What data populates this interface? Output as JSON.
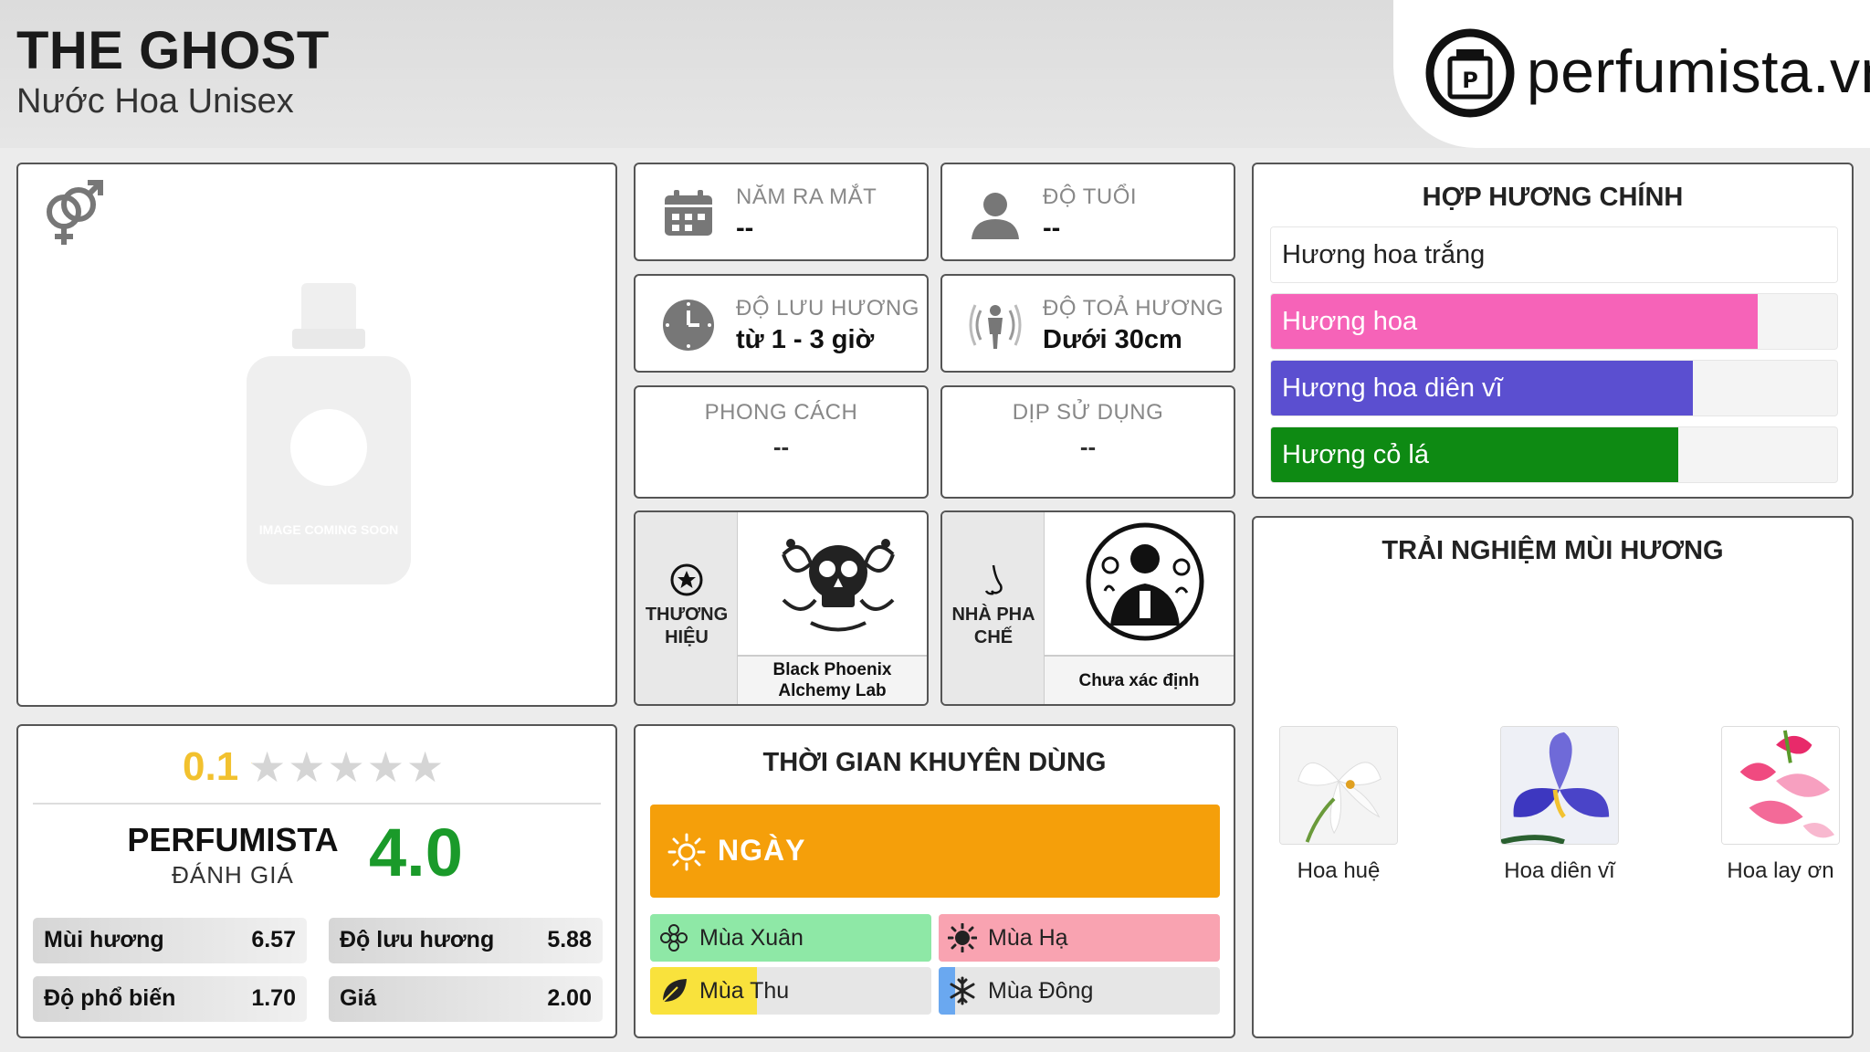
{
  "header": {
    "title": "THE GHOST",
    "subtitle": "Nước Hoa Unisex",
    "brand": "perfumista.vn"
  },
  "image": {
    "icon": "gender-unisex-icon",
    "bottle_caption": "IMAGE COMING SOON"
  },
  "info": {
    "release": {
      "label": "NĂM RA MẮT",
      "value": "--",
      "icon": "calendar-icon"
    },
    "age": {
      "label": "ĐỘ TUỔI",
      "value": "--",
      "icon": "person-icon"
    },
    "longevity": {
      "label": "ĐỘ LƯU HƯƠNG",
      "value": "từ 1 - 3 giờ",
      "icon": "clock-icon"
    },
    "sillage": {
      "label": "ĐỘ TOẢ HƯƠNG",
      "value": "Dưới 30cm",
      "icon": "sillage-icon"
    },
    "style": {
      "label": "PHONG CÁCH",
      "value": "--"
    },
    "occasion": {
      "label": "DỊP SỬ DỤNG",
      "value": "--"
    },
    "brand": {
      "label": "THƯƠNG HIỆU",
      "value": "Black Phoenix Alchemy Lab",
      "icon": "star-circle-icon"
    },
    "perfumer": {
      "label": "NHÀ PHA CHẾ",
      "value": "Chưa xác định",
      "icon": "nose-icon"
    }
  },
  "notes": {
    "title": "HỢP HƯƠNG CHÍNH",
    "items": [
      {
        "label": "Hương hoa trắng",
        "percent": 100,
        "color": "#ffffff"
      },
      {
        "label": "Hương hoa",
        "percent": 86,
        "color": "#f663b8"
      },
      {
        "label": "Hương hoa diên vĩ",
        "percent": 74.5,
        "color": "#5b4fd0"
      },
      {
        "label": "Hương cỏ lá",
        "percent": 72,
        "color": "#0e8a13"
      }
    ]
  },
  "experience": {
    "title": "TRẢI NGHIỆM MÙI HƯƠNG",
    "items": [
      {
        "label": "Hoa huệ",
        "icon": "lily-flower-image"
      },
      {
        "label": "Hoa diên vĩ",
        "icon": "iris-flower-image"
      },
      {
        "label": "Hoa lay ơn",
        "icon": "gladiolus-flower-image"
      }
    ]
  },
  "rating": {
    "user_score": "0.1",
    "stars_filled": 0.02,
    "perfumista_label": "PERFUMISTA",
    "perfumista_sub": "ĐÁNH GIÁ",
    "perfumista_score": "4.0",
    "metrics": [
      {
        "label": "Mùi hương",
        "value": "6.57"
      },
      {
        "label": "Độ lưu hương",
        "value": "5.88"
      },
      {
        "label": "Độ phổ biến",
        "value": "1.70"
      },
      {
        "label": "Giá",
        "value": "2.00"
      }
    ]
  },
  "time": {
    "title": "THỜI GIAN KHUYÊN DÙNG",
    "day_label": "NGÀY",
    "day_color": "#f59f0a",
    "seasons": [
      {
        "label": "Mùa Xuân",
        "icon": "spring-flower-icon",
        "fill": 1.0,
        "color": "#8ee8a6"
      },
      {
        "label": "Mùa Hạ",
        "icon": "sun-icon",
        "fill": 1.0,
        "color": "#f9a3b1"
      },
      {
        "label": "Mùa Thu",
        "icon": "leaf-icon",
        "fill": 0.38,
        "color": "#f9e23c"
      },
      {
        "label": "Mùa Đông",
        "icon": "snowflake-icon",
        "fill": 0.06,
        "color": "#6aa8f0"
      }
    ]
  }
}
